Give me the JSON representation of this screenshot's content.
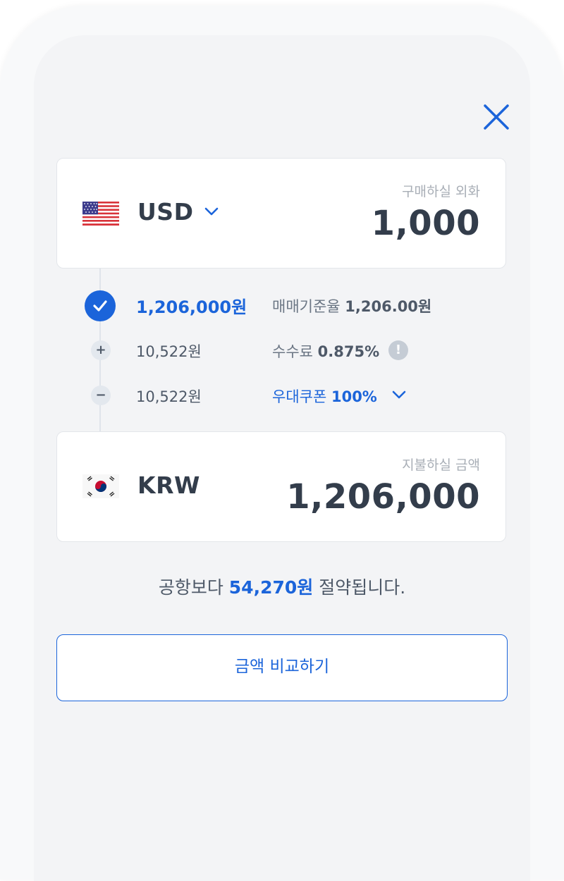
{
  "colors": {
    "accent": "#1b64da",
    "text_primary": "#333d4b",
    "text_secondary": "#6b7684",
    "label_gray": "#a8aeb6"
  },
  "close": {
    "icon": "close-icon"
  },
  "source": {
    "flag_icon": "us-flag-icon",
    "currency": "USD",
    "label": "구매하실 외화",
    "amount": "1,000"
  },
  "breakdown": {
    "base": {
      "amount": "1,206,000원",
      "desc_label": "매매기준율",
      "desc_value": "1,206.00원"
    },
    "fee": {
      "sign": "+",
      "amount": "10,522원",
      "desc_label": "수수료",
      "desc_value": "0.875%",
      "info": "!"
    },
    "coupon": {
      "sign": "−",
      "amount": "10,522원",
      "desc_label": "우대쿠폰",
      "desc_value": "100%"
    }
  },
  "target": {
    "flag_icon": "kr-flag-icon",
    "currency": "KRW",
    "label": "지불하실 금액",
    "amount": "1,206,000"
  },
  "savings": {
    "prefix": "공항보다",
    "amount": "54,270원",
    "suffix": "절약됩니다."
  },
  "compare_button": "금액 비교하기"
}
